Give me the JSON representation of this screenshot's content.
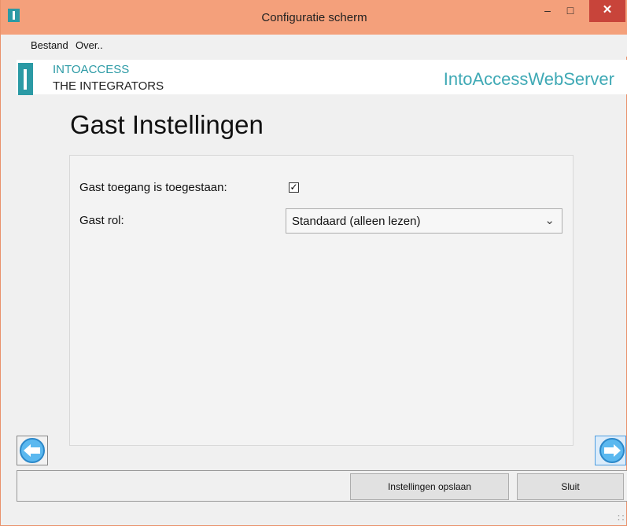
{
  "window": {
    "title": "Configuratie scherm",
    "min_glyph": "–",
    "max_glyph": "□",
    "close_glyph": "✕"
  },
  "menu": {
    "items": [
      {
        "label": "Bestand"
      },
      {
        "label": "Over.."
      }
    ]
  },
  "brand": {
    "logo_line1": "INTOACCESS",
    "logo_line2": "THE INTEGRATORS",
    "product_name": "IntoAccessWebServer",
    "accent_color": "#2b9aa5"
  },
  "page": {
    "title": "Gast Instellingen"
  },
  "form": {
    "guest_access_label": "Gast toegang is toegestaan:",
    "guest_access_checked": true,
    "guest_access_glyph": "✓",
    "guest_role_label": "Gast rol:",
    "guest_role_value": "Standaard (alleen lezen)",
    "dropdown_arrow": "⌄"
  },
  "nav": {
    "back_icon": "arrow-left-circle-icon",
    "forward_icon": "arrow-right-circle-icon"
  },
  "buttons": {
    "save_label": "Instellingen opslaan",
    "close_label": "Sluit"
  },
  "status": {
    "grip_glyph": "⠨⠨"
  }
}
